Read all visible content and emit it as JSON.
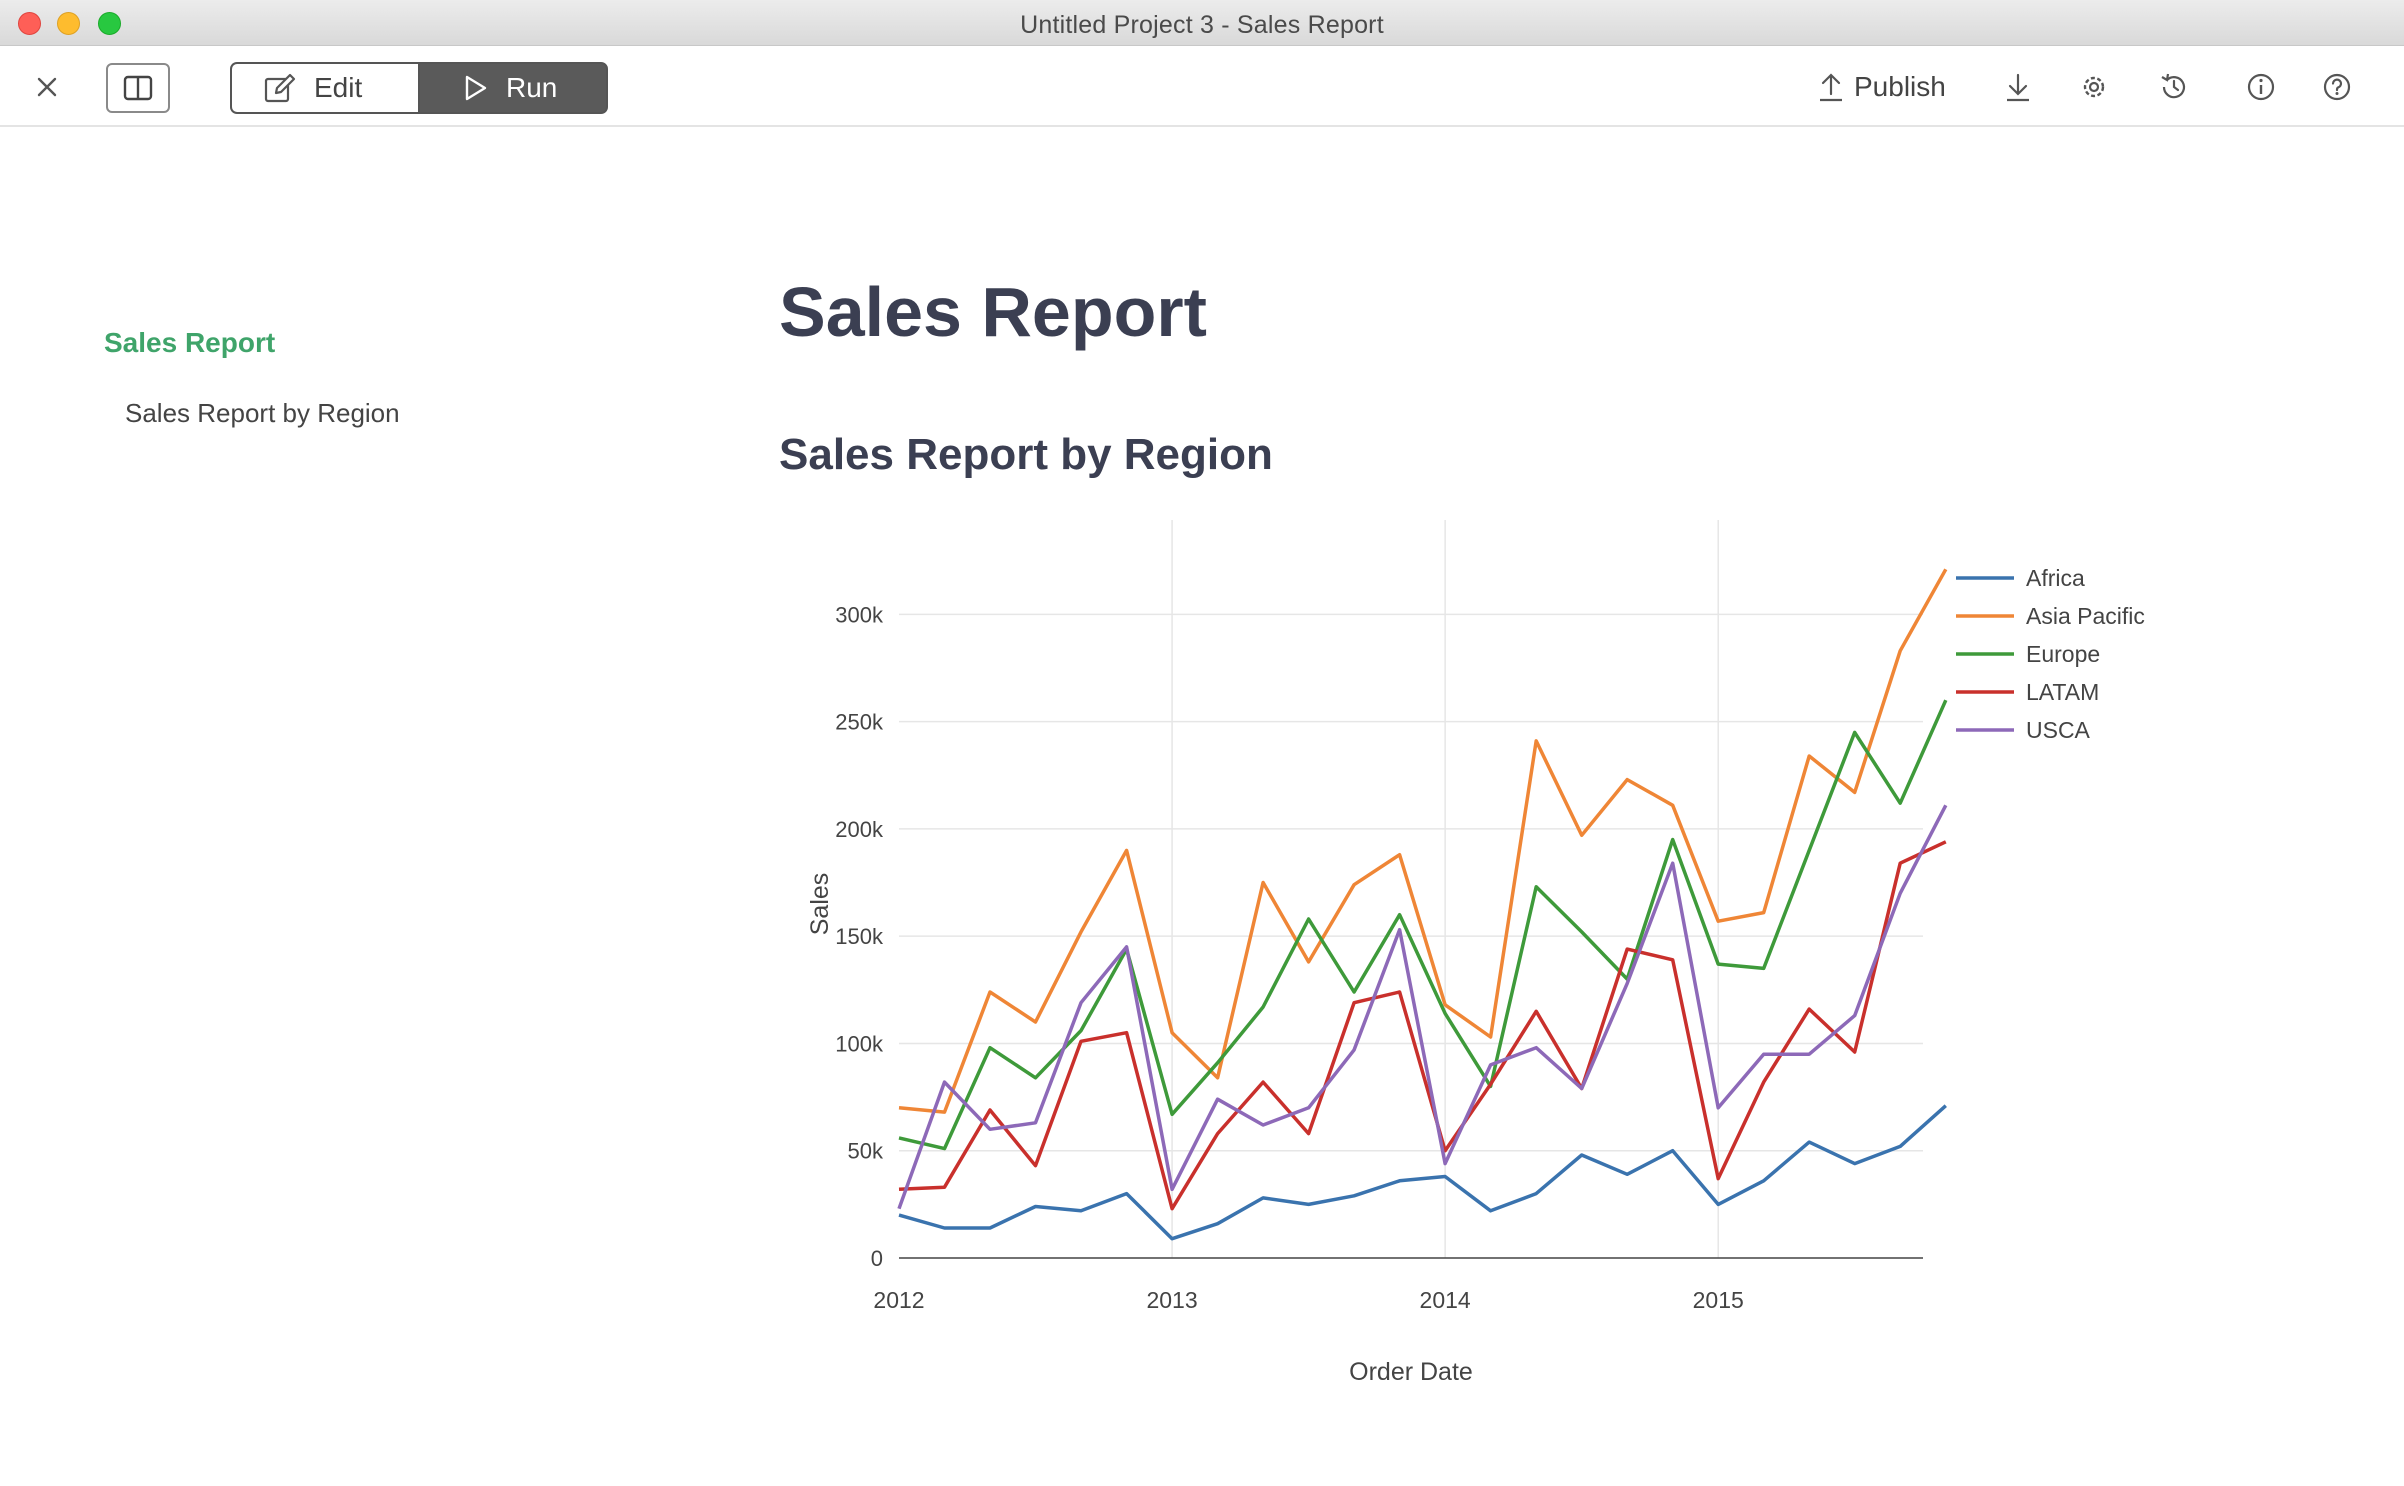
{
  "window": {
    "title": "Untitled Project 3 - Sales Report"
  },
  "toolbar": {
    "edit_label": "Edit",
    "run_label": "Run",
    "publish_label": "Publish",
    "icons": [
      "close-icon",
      "split-view-icon",
      "pencil-icon",
      "play-icon",
      "upload-icon",
      "download-icon",
      "gear-icon",
      "history-icon",
      "info-icon",
      "help-icon"
    ]
  },
  "sidebar": {
    "title": "Sales Report",
    "items": [
      {
        "label": "Sales Report by Region"
      }
    ]
  },
  "main": {
    "title": "Sales Report",
    "section_title": "Sales Report by Region"
  },
  "colors": {
    "accent_green": "#3fa46a",
    "heading": "#3b3f52",
    "run_button_bg": "#5a5a5a"
  },
  "chart_data": {
    "type": "line",
    "title": "",
    "xlabel": "Order Date",
    "ylabel": "Sales",
    "x_ticks": [
      "2012",
      "2013",
      "2014",
      "2015"
    ],
    "y_ticks": [
      "0",
      "50k",
      "100k",
      "150k",
      "200k",
      "250k",
      "300k"
    ],
    "ylim": [
      0,
      330000
    ],
    "xlim": [
      "2012-01",
      "2015-10"
    ],
    "grid": true,
    "legend": "top-right",
    "x": [
      "2012-01",
      "2012-03",
      "2012-05",
      "2012-07",
      "2012-09",
      "2012-11",
      "2013-01",
      "2013-03",
      "2013-05",
      "2013-07",
      "2013-09",
      "2013-11",
      "2014-01",
      "2014-03",
      "2014-05",
      "2014-07",
      "2014-09",
      "2014-11",
      "2015-01",
      "2015-03",
      "2015-05",
      "2015-07",
      "2015-09",
      "2015-11"
    ],
    "series": [
      {
        "name": "Africa",
        "color": "#3a73ae",
        "values": [
          20000,
          14000,
          14000,
          24000,
          22000,
          30000,
          9000,
          16000,
          28000,
          25000,
          29000,
          36000,
          38000,
          22000,
          30000,
          48000,
          39000,
          50000,
          25000,
          36000,
          54000,
          44000,
          52000,
          71000
        ]
      },
      {
        "name": "Asia Pacific",
        "color": "#ef8636",
        "values": [
          70000,
          68000,
          124000,
          110000,
          152000,
          190000,
          105000,
          84000,
          175000,
          138000,
          174000,
          188000,
          118000,
          103000,
          241000,
          197000,
          223000,
          211000,
          157000,
          161000,
          234000,
          217000,
          283000,
          321000
        ]
      },
      {
        "name": "Europe",
        "color": "#3e9a3a",
        "values": [
          56000,
          51000,
          98000,
          84000,
          106000,
          144000,
          67000,
          91000,
          117000,
          158000,
          124000,
          160000,
          114000,
          80000,
          173000,
          152000,
          130000,
          195000,
          137000,
          135000,
          190000,
          245000,
          212000,
          260000
        ]
      },
      {
        "name": "LATAM",
        "color": "#c9302c",
        "values": [
          32000,
          33000,
          69000,
          43000,
          101000,
          105000,
          23000,
          58000,
          82000,
          58000,
          119000,
          124000,
          50000,
          81000,
          115000,
          79000,
          144000,
          139000,
          37000,
          82000,
          116000,
          96000,
          184000,
          194000
        ]
      },
      {
        "name": "USCA",
        "color": "#8d69b8",
        "values": [
          23000,
          82000,
          60000,
          63000,
          119000,
          145000,
          32000,
          74000,
          62000,
          70000,
          97000,
          153000,
          44000,
          90000,
          98000,
          79000,
          128000,
          184000,
          70000,
          95000,
          95000,
          113000,
          170000,
          211000
        ]
      }
    ]
  }
}
